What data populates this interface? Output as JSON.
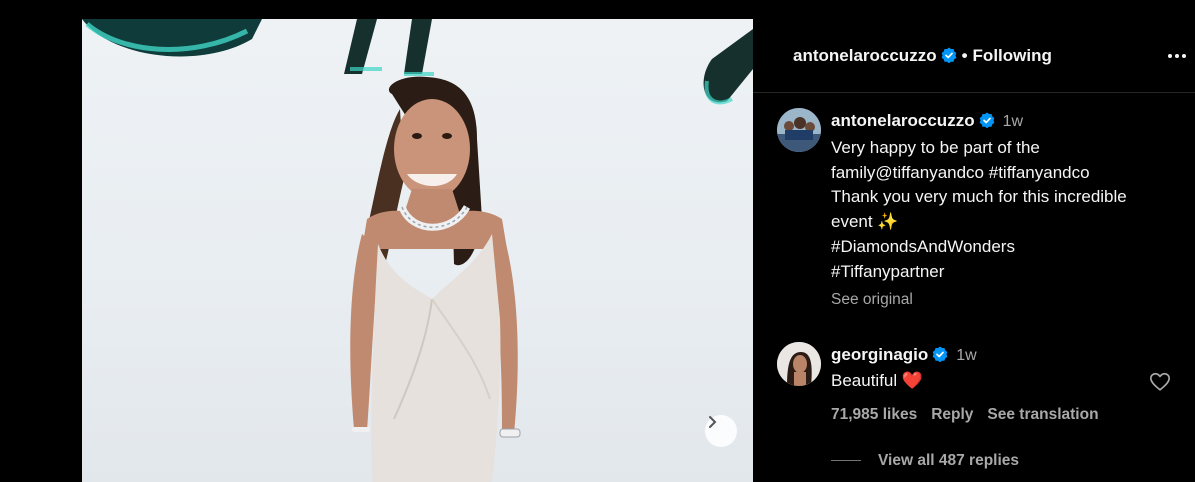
{
  "header": {
    "username": "antonelaroccuzzo",
    "separator": "•",
    "follow_status": "Following"
  },
  "caption": {
    "username": "antonelaroccuzzo",
    "time": "1w",
    "lines": [
      "Very happy to be part of the",
      "family@tiffanyandco #tiffanyandco",
      "Thank you very much for this incredible",
      "event ✨",
      "#DiamondsAndWonders",
      "#Tiffanypartner"
    ],
    "see_original": "See original"
  },
  "comment": {
    "username": "georginagio",
    "time": "1w",
    "text": "Beautiful ❤️",
    "likes": "71,985 likes",
    "reply_label": "Reply",
    "translation_label": "See translation",
    "view_replies": "View all 487 replies"
  },
  "colors": {
    "background": "#000000",
    "verified": "#0095f6",
    "secondary_text": "#a8a8a8",
    "heart_emoji": "#e0245e"
  },
  "icons": [
    "verified-badge-icon",
    "more-options-icon",
    "heart-icon",
    "chevron-right-icon"
  ]
}
